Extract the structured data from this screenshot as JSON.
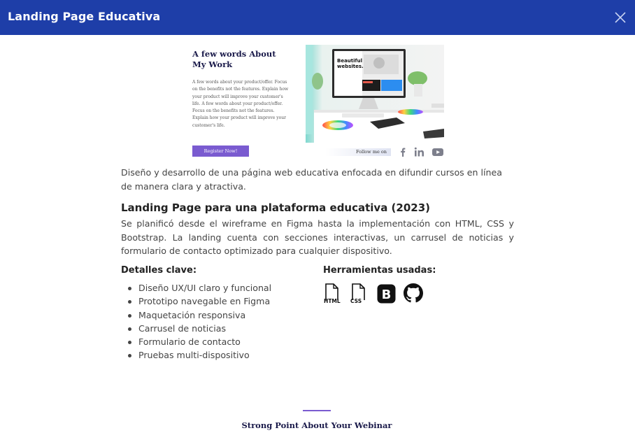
{
  "modal": {
    "title": "Landing Page Educativa",
    "header_color": "#1e3ea8"
  },
  "preview": {
    "heading": "A few words About My Work",
    "body": "A few words about your product/offer. Focus on the benefits not the features. Explain how your product will improve your customer's life. A few words about your product/offer. Focus on the benefits not the features. Explain how your product will improve your customer's life.",
    "register_label": "Register Now!",
    "photo_caption": "Beautiful websites.",
    "follow_label": "Follow me on",
    "social_icons": [
      "facebook-icon",
      "linkedin-icon",
      "youtube-icon"
    ],
    "accent_color": "#7a5bd0"
  },
  "description": "Diseño y desarrollo de una página web educativa enfocada en difundir cursos en línea de manera clara y atractiva.",
  "project": {
    "title": "Landing Page para una plataforma educativa (2023)",
    "description": "Se planificó desde el wireframe en Figma hasta la implementación con HTML, CSS y Bootstrap. La landing cuenta con secciones interactivas, un carrusel de noticias y formulario de contacto optimizado para cualquier dispositivo."
  },
  "details": {
    "title": "Detalles clave:",
    "items": [
      "Diseño UX/UI claro y funcional",
      "Prototipo navegable en Figma",
      "Maquetación responsiva",
      "Carrusel de noticias",
      "Formulario de contacto",
      "Pruebas multi-dispositivo"
    ]
  },
  "tools": {
    "title": "Herramientas usadas:",
    "items": [
      {
        "name": "html-file-icon",
        "label": "HTML"
      },
      {
        "name": "css-file-icon",
        "label": "CSS"
      },
      {
        "name": "bootstrap-icon",
        "label": "B"
      },
      {
        "name": "github-icon",
        "label": ""
      }
    ]
  },
  "footer_preview": {
    "title": "Strong Point About Your Webinar"
  }
}
